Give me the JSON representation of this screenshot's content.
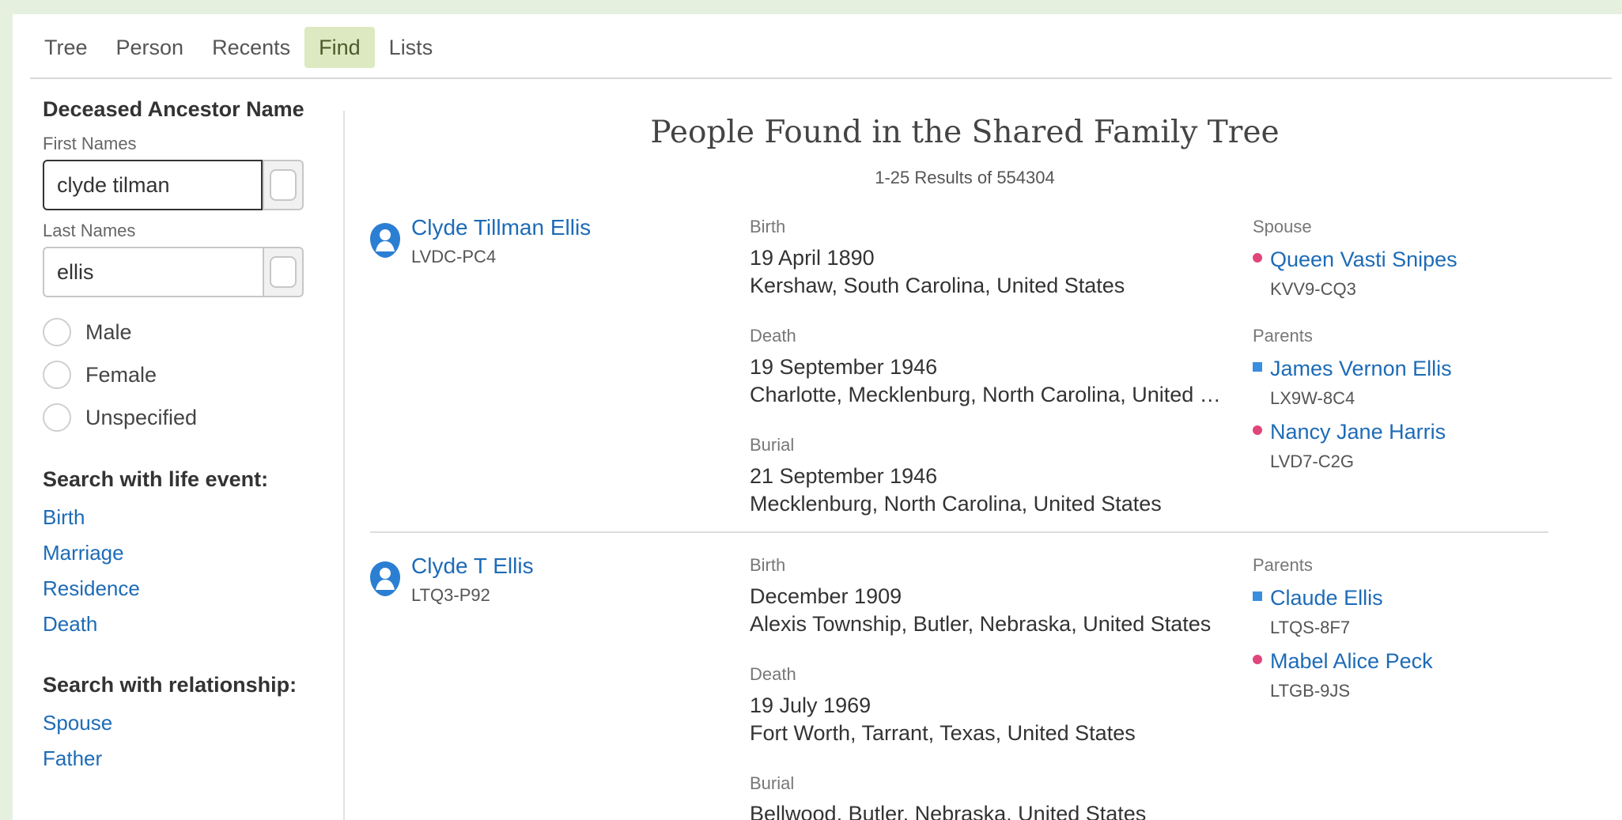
{
  "nav": {
    "items": [
      {
        "label": "Tree"
      },
      {
        "label": "Person"
      },
      {
        "label": "Recents"
      },
      {
        "label": "Find"
      },
      {
        "label": "Lists"
      }
    ],
    "active": "Find"
  },
  "sidebar": {
    "title": "Deceased Ancestor Name",
    "first_names_label": "First Names",
    "first_names_value": "clyde tilman",
    "last_names_label": "Last Names",
    "last_names_value": "ellis",
    "genders": [
      "Male",
      "Female",
      "Unspecified"
    ],
    "life_event_title": "Search with life event:",
    "life_events": [
      "Birth",
      "Marriage",
      "Residence",
      "Death"
    ],
    "relationship_title": "Search with relationship:",
    "relationships": [
      "Spouse",
      "Father"
    ]
  },
  "main": {
    "title": "People Found in the Shared Family Tree",
    "results_count": "1-25 Results of 554304"
  },
  "results": [
    {
      "name": "Clyde Tillman Ellis",
      "id": "LVDC-PC4",
      "events": [
        {
          "label": "Birth",
          "date": "19 April 1890",
          "place": "Kershaw, South Carolina, United States"
        },
        {
          "label": "Death",
          "date": "19 September 1946",
          "place": "Charlotte, Mecklenburg, North Carolina, United St..."
        },
        {
          "label": "Burial",
          "date": "21 September 1946",
          "place": "Mecklenburg, North Carolina, United States"
        }
      ],
      "spouse_label": "Spouse",
      "spouse": {
        "name": "Queen Vasti Snipes",
        "id": "KVV9-CQ3",
        "sex": "female"
      },
      "parents_label": "Parents",
      "parents": [
        {
          "name": "James Vernon Ellis",
          "id": "LX9W-8C4",
          "sex": "male"
        },
        {
          "name": "Nancy Jane Harris",
          "id": "LVD7-C2G",
          "sex": "female"
        }
      ]
    },
    {
      "name": "Clyde T Ellis",
      "id": "LTQ3-P92",
      "events": [
        {
          "label": "Birth",
          "date": "December 1909",
          "place": "Alexis Township, Butler, Nebraska, United States"
        },
        {
          "label": "Death",
          "date": "19 July 1969",
          "place": "Fort Worth, Tarrant, Texas, United States"
        },
        {
          "label": "Burial",
          "date": "",
          "place": "Bellwood, Butler, Nebraska, United States"
        }
      ],
      "parents_label": "Parents",
      "parents": [
        {
          "name": "Claude Ellis",
          "id": "LTQS-8F7",
          "sex": "male"
        },
        {
          "name": "Mabel Alice Peck",
          "id": "LTGB-9JS",
          "sex": "female"
        }
      ]
    }
  ],
  "colors": {
    "page_bg": "#e6f0df",
    "link": "#1d6bb6",
    "nav_active_bg": "#dde9c0",
    "male_marker": "#3a8ee0",
    "female_marker": "#e0457b",
    "avatar": "#2b7fd3"
  },
  "icons": {
    "avatar": "person-avatar-icon",
    "male_marker": "male-square-icon",
    "female_marker": "female-dot-icon"
  }
}
